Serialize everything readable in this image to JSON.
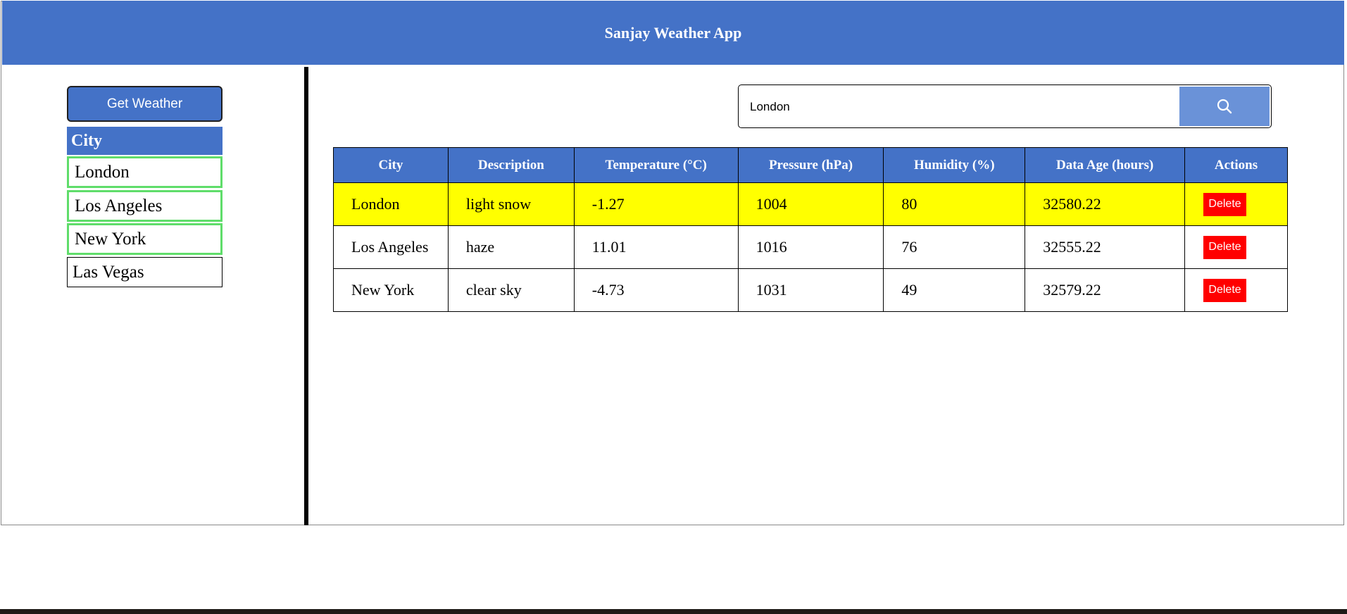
{
  "header": {
    "title": "Sanjay Weather App"
  },
  "sidebar": {
    "get_weather_label": "Get Weather",
    "city_header": "City",
    "cities": [
      {
        "label": "London",
        "selected": true
      },
      {
        "label": "Los Angeles",
        "selected": true
      },
      {
        "label": "New York",
        "selected": true
      },
      {
        "label": "Las Vegas",
        "selected": false
      }
    ]
  },
  "search": {
    "value": "London",
    "icon": "search-icon",
    "button_color": "#6a92d8"
  },
  "table": {
    "columns": [
      "City",
      "Description",
      "Temperature (°C)",
      "Pressure (hPa)",
      "Humidity (%)",
      "Data Age (hours)",
      "Actions"
    ],
    "rows": [
      {
        "city": "London",
        "description": "light snow",
        "temperature": "-1.27",
        "pressure": "1004",
        "humidity": "80",
        "data_age": "32580.22",
        "action_label": "Delete",
        "highlighted": true
      },
      {
        "city": "Los Angeles",
        "description": "haze",
        "temperature": "11.01",
        "pressure": "1016",
        "humidity": "76",
        "data_age": "32555.22",
        "action_label": "Delete",
        "highlighted": false
      },
      {
        "city": "New York",
        "description": "clear sky",
        "temperature": "-4.73",
        "pressure": "1031",
        "humidity": "49",
        "data_age": "32579.22",
        "action_label": "Delete",
        "highlighted": false
      }
    ]
  },
  "colors": {
    "header_bg": "#4472c7",
    "highlight_row": "#ffff00",
    "delete_button": "#ff0000",
    "selected_city_border": "#5fdd6a"
  }
}
